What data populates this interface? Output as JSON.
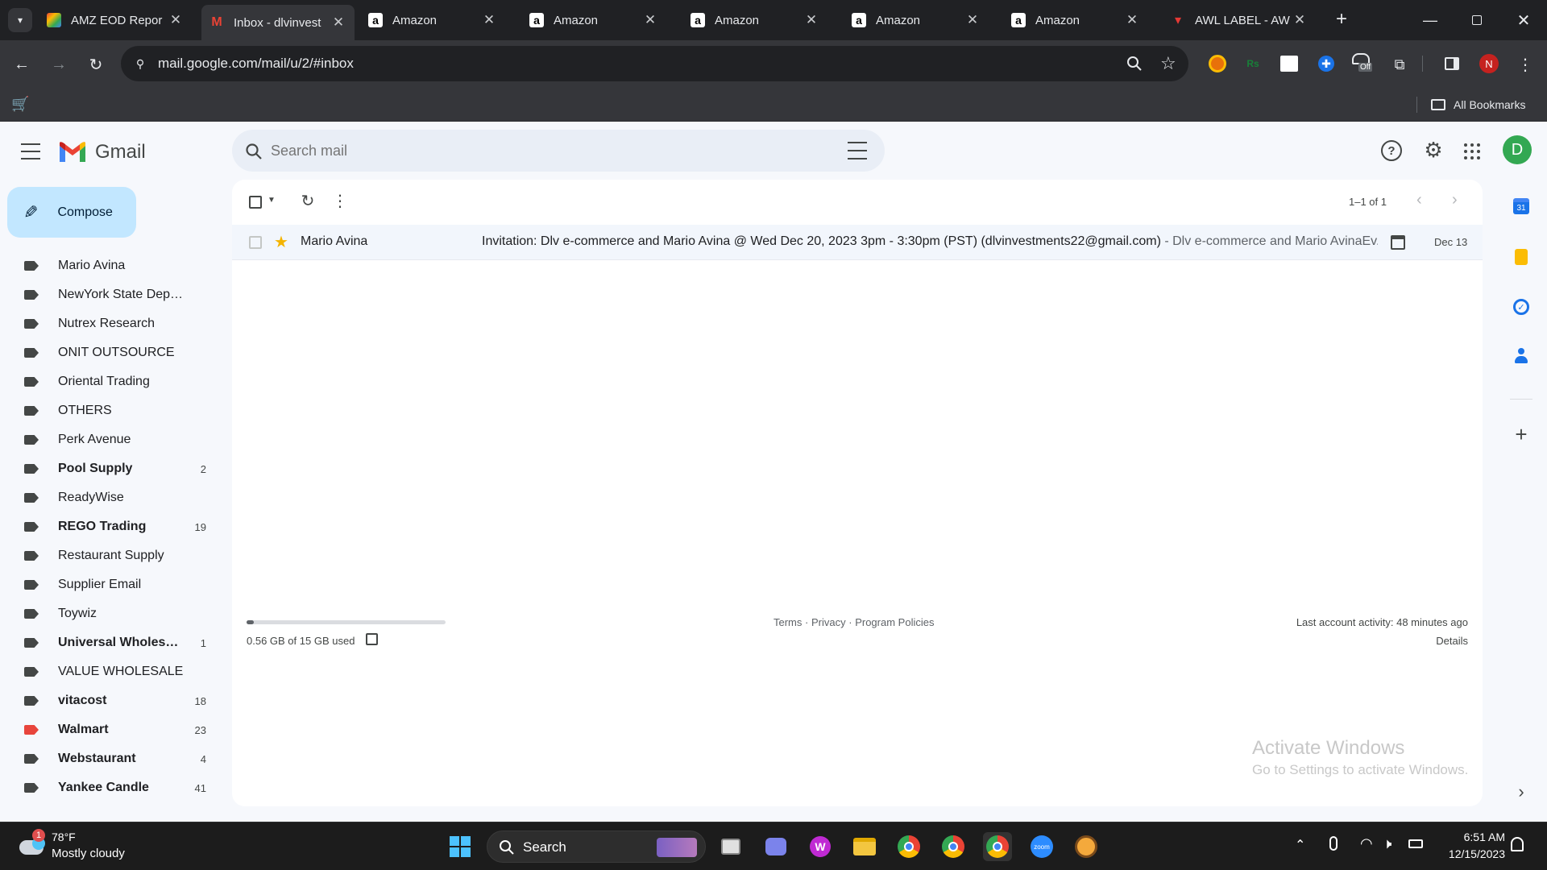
{
  "browser": {
    "tabs": [
      {
        "title": "AMZ EOD Repor",
        "icon": "sheets-icon",
        "active": false
      },
      {
        "title": "Inbox - dlvinvest",
        "icon": "gmail-icon",
        "active": true
      },
      {
        "title": "Amazon",
        "icon": "amazon-icon",
        "active": false
      },
      {
        "title": "Amazon",
        "icon": "amazon-icon",
        "active": false
      },
      {
        "title": "Amazon",
        "icon": "amazon-icon",
        "active": false
      },
      {
        "title": "Amazon",
        "icon": "amazon-icon",
        "active": false
      },
      {
        "title": "Amazon",
        "icon": "amazon-icon",
        "active": false
      },
      {
        "title": "AWL LABEL - AW",
        "icon": "awl-icon",
        "active": false
      }
    ],
    "url": "mail.google.com/mail/u/2/#inbox",
    "profile_initial": "N",
    "bookmarks_label": "All Bookmarks",
    "extension_badge": "Off"
  },
  "gmail": {
    "brand": "Gmail",
    "search_placeholder": "Search mail",
    "compose_label": "Compose",
    "account_initial": "D",
    "labels": [
      {
        "name": "Mario Avina",
        "count": "",
        "bold": false,
        "color": "#444746"
      },
      {
        "name": "NewYork State Departm...",
        "count": "",
        "bold": false,
        "color": "#444746"
      },
      {
        "name": "Nutrex Research",
        "count": "",
        "bold": false,
        "color": "#444746"
      },
      {
        "name": "ONIT OUTSOURCE",
        "count": "",
        "bold": false,
        "color": "#444746"
      },
      {
        "name": "Oriental Trading",
        "count": "",
        "bold": false,
        "color": "#444746"
      },
      {
        "name": "OTHERS",
        "count": "",
        "bold": false,
        "color": "#444746"
      },
      {
        "name": "Perk Avenue",
        "count": "",
        "bold": false,
        "color": "#444746"
      },
      {
        "name": "Pool Supply",
        "count": "2",
        "bold": true,
        "color": "#444746"
      },
      {
        "name": "ReadyWise",
        "count": "",
        "bold": false,
        "color": "#444746"
      },
      {
        "name": "REGO Trading",
        "count": "19",
        "bold": true,
        "color": "#444746"
      },
      {
        "name": "Restaurant Supply",
        "count": "",
        "bold": false,
        "color": "#444746"
      },
      {
        "name": "Supplier Email",
        "count": "",
        "bold": false,
        "color": "#444746"
      },
      {
        "name": "Toywiz",
        "count": "",
        "bold": false,
        "color": "#444746"
      },
      {
        "name": "Universal Wholesal...",
        "count": "1",
        "bold": true,
        "color": "#444746"
      },
      {
        "name": "VALUE WHOLESALE",
        "count": "",
        "bold": false,
        "color": "#444746"
      },
      {
        "name": "vitacost",
        "count": "18",
        "bold": true,
        "color": "#444746"
      },
      {
        "name": "Walmart",
        "count": "23",
        "bold": true,
        "color": "#e8453c"
      },
      {
        "name": "Webstaurant",
        "count": "4",
        "bold": true,
        "color": "#444746"
      },
      {
        "name": "Yankee Candle",
        "count": "41",
        "bold": true,
        "color": "#444746"
      }
    ],
    "pagination": "1–1 of 1",
    "email": {
      "sender": "Mario Avina",
      "subject": "Invitation: Dlv e-commerce and Mario Avina @ Wed Dec 20, 2023 3pm - 3:30pm (PST) (dlvinvestments22@gmail.com)",
      "snippet": " - Dlv e-commerce and Mario AvinaEv...",
      "date": "Dec 13",
      "starred": true
    },
    "footer": {
      "storage": "0.56 GB of 15 GB used",
      "storage_fraction": 0.037,
      "terms": "Terms",
      "privacy": "Privacy",
      "policies": "Program Policies",
      "sep": "·",
      "activity": "Last account activity: 48 minutes ago",
      "details": "Details"
    },
    "watermark": {
      "line1": "Activate Windows",
      "line2": "Go to Settings to activate Windows."
    }
  },
  "taskbar": {
    "weather_temp": "78°F",
    "weather_desc": "Mostly cloudy",
    "weather_badge": "1",
    "search_label": "Search",
    "time": "6:51 AM",
    "date": "12/15/2023",
    "zoom_label": "zoom"
  }
}
